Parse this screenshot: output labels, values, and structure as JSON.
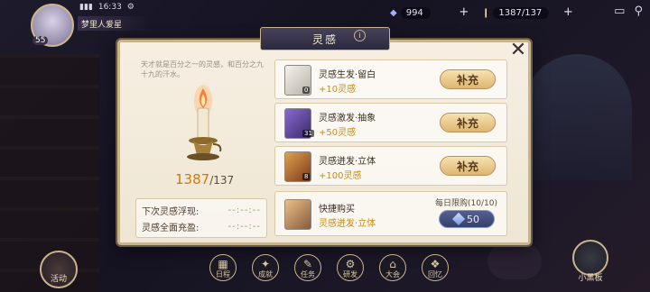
{
  "player": {
    "level": "55",
    "name": "梦里人爱星",
    "time": "16:33"
  },
  "resources": {
    "gems": "994",
    "stamina": "1387/137"
  },
  "dialog": {
    "title": "灵感",
    "description": "天才就是百分之一的灵感，和百分之九十九的汗水。",
    "current": "1387",
    "max": "/137",
    "next_label": "下次灵感浮现:",
    "next_value": "--:--:--",
    "full_label": "灵感全面充盈:",
    "full_value": "--:--:--",
    "items": [
      {
        "name": "灵感生发·留白",
        "bonus": "+10灵感",
        "qty": "0",
        "button": "补充",
        "color": "#e8e4dc"
      },
      {
        "name": "灵感激发·抽象",
        "bonus": "+50灵感",
        "qty": "31",
        "button": "补充",
        "color": "#6a4aa0"
      },
      {
        "name": "灵感迸发·立体",
        "bonus": "+100灵感",
        "qty": "8",
        "button": "补充",
        "color": "#b06a2a"
      }
    ],
    "quick_buy": {
      "name": "快捷购买",
      "sub": "灵感迸发·立体",
      "limit": "每日限购(10/10)",
      "price": "50"
    }
  },
  "bottom_nav": [
    {
      "label": "日程",
      "icon": "calendar-icon",
      "sym": "▦"
    },
    {
      "label": "成就",
      "icon": "star-icon",
      "sym": "✦"
    },
    {
      "label": "任务",
      "icon": "task-icon",
      "sym": "✎"
    },
    {
      "label": "研发",
      "icon": "research-icon",
      "sym": "⚙"
    },
    {
      "label": "大会",
      "icon": "hall-icon",
      "sym": "⌂"
    },
    {
      "label": "回忆",
      "icon": "memory-icon",
      "sym": "❖"
    }
  ],
  "event_label": "活动",
  "blackboard_label": "小黑板"
}
